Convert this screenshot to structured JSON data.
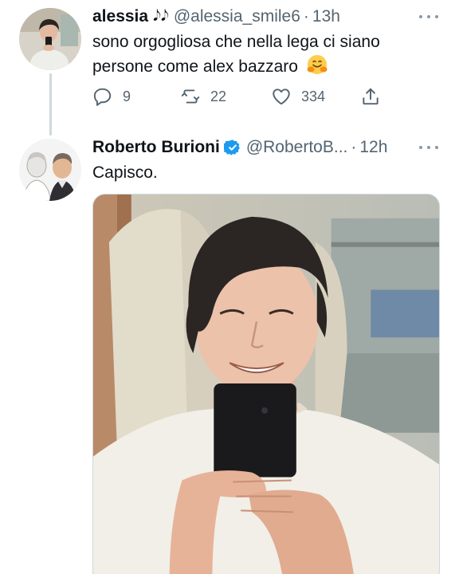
{
  "tweets": [
    {
      "name": "alessia",
      "name_emoji": "𝅘𝅥𝅮𝅘𝅥𝅮",
      "handle": "@alessia_smile6",
      "separator": "·",
      "time": "13h",
      "text": "sono orgogliosa che nella lega ci siano persone come alex bazzaro",
      "text_emoji": "hugging-face-emoji",
      "actions": {
        "reply_count": "9",
        "retweet_count": "22",
        "like_count": "334"
      }
    },
    {
      "name": "Roberto Burioni",
      "verified": true,
      "handle": "@RobertoB...",
      "separator": "·",
      "time": "12h",
      "text": "Capisco.",
      "media": "photo"
    }
  ],
  "colors": {
    "text": "#0f1419",
    "secondary": "#536471",
    "verified": "#1d9bf0",
    "thread_line": "#cfd9de"
  },
  "icons": [
    "reply-icon",
    "retweet-icon",
    "like-icon",
    "share-icon",
    "verified-icon",
    "more-icon"
  ]
}
